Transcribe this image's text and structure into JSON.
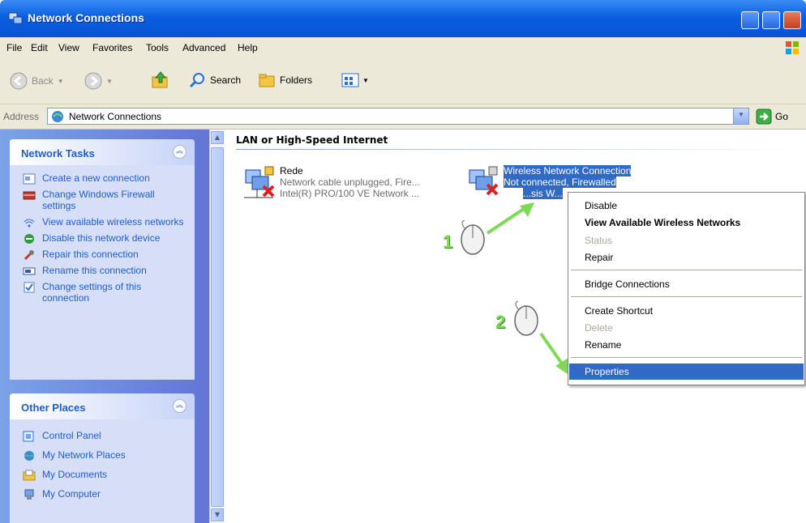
{
  "window": {
    "title": "Network Connections"
  },
  "menubar": {
    "items": [
      "File",
      "Edit",
      "View",
      "Favorites",
      "Tools",
      "Advanced",
      "Help"
    ]
  },
  "toolbar": {
    "back": "Back",
    "search": "Search",
    "folders": "Folders"
  },
  "address": {
    "label": "Address",
    "value": "Network Connections",
    "go": "Go"
  },
  "network_tasks": {
    "title": "Network Tasks",
    "items": [
      "Create a new connection",
      "Change Windows Firewall settings",
      "View available wireless networks",
      "Disable this network device",
      "Repair this connection",
      "Rename this connection",
      "Change settings of this connection"
    ]
  },
  "other_places": {
    "title": "Other Places",
    "items": [
      "Control Panel",
      "My Network Places",
      "My Documents",
      "My Computer"
    ]
  },
  "content": {
    "group_title": "LAN or High-Speed Internet",
    "connections": [
      {
        "name": "Rede",
        "status": "Network cable unplugged, Fire...",
        "device": "Intel(R) PRO/100 VE Network ..."
      },
      {
        "name": "Wireless Network Connection",
        "status": "Not connected, Firewalled",
        "device": "...sis W..."
      }
    ]
  },
  "context_menu": {
    "items": [
      "Disable",
      "View Available Wireless Networks",
      "Status",
      "Repair",
      "Bridge Connections",
      "Create Shortcut",
      "Delete",
      "Rename",
      "Properties"
    ]
  },
  "annotations": [
    "1",
    "2"
  ],
  "colors": {
    "accent": "#316ac5",
    "titlebar": "#0a5fe0",
    "task_link": "#215dc6",
    "annotation": "#7ed957"
  }
}
